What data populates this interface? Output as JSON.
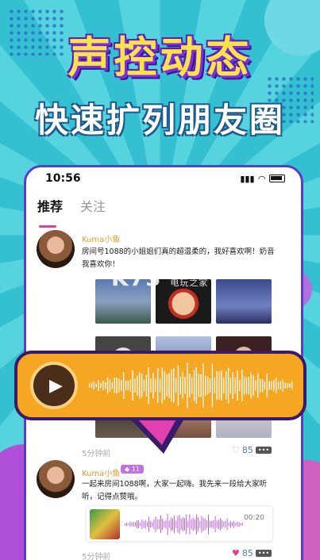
{
  "banner": {
    "title": "声控动态",
    "subtitle": "快速扩列朋友圈"
  },
  "status_bar": {
    "time": "10:56"
  },
  "tabs": [
    {
      "label": "推荐",
      "active": true
    },
    {
      "label": "关注",
      "active": false
    }
  ],
  "posts": [
    {
      "user": "Kuma小鱼",
      "text": "房间号1088的小姐姐们真的超温柔的，我好喜欢啊！奶音我喜欢你！",
      "time": "5分钟前",
      "likes": "85",
      "images": [
        "lake-landscape",
        "anime-boy",
        "night-sky",
        "husky-dog",
        "anime-art",
        "girl-portrait"
      ]
    },
    {
      "user": "Kuma小鱼",
      "badge": "11",
      "text": "一起来房间1088啊，大家一起嗨。我先来一段给大家听听，记得点赞哦。",
      "time": "5分钟前",
      "likes": "85",
      "audio_duration": "00:20"
    }
  ],
  "watermark": {
    "main": "K73",
    "sub": "电玩之家"
  },
  "colors": {
    "accent": "#e040a0",
    "player": "#f5a623",
    "player_border": "#3b1a6a",
    "username": "#e89a2a"
  },
  "icons": [
    "play-icon",
    "heart-icon",
    "more-icon",
    "signal-icon",
    "wifi-icon",
    "battery-icon"
  ]
}
